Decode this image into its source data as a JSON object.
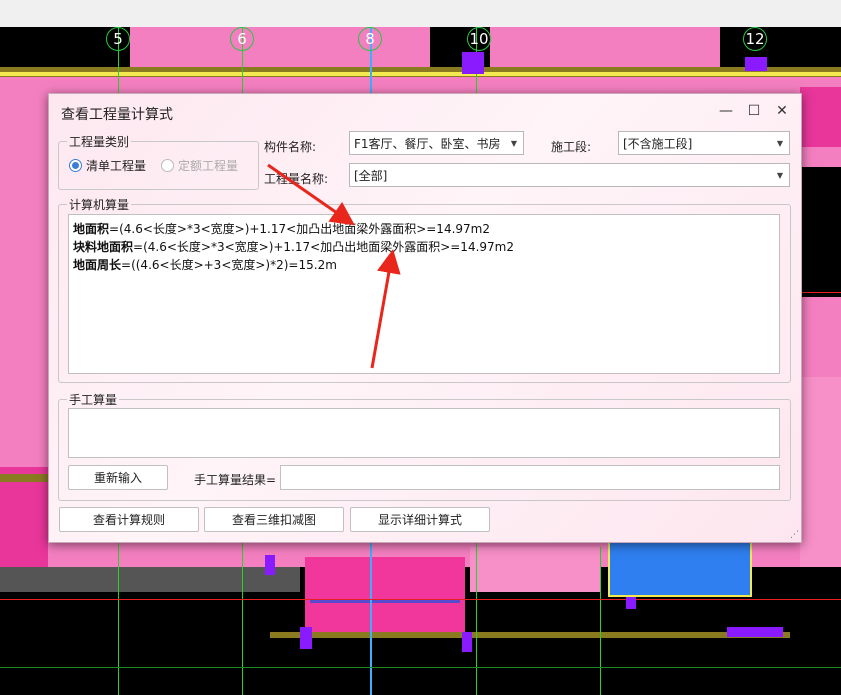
{
  "cad": {
    "axis_numbers": [
      "5",
      "6",
      "8",
      "10",
      "12"
    ]
  },
  "dialog": {
    "title": "查看工程量计算式",
    "minimize_glyph": "—",
    "maximize_glyph": "☐",
    "close_glyph": "✕",
    "category_group": "工程量类别",
    "radio_bill": "清单工程量",
    "radio_quota": "定额工程量",
    "component_label": "构件名称:",
    "component_value": "F1客厅、餐厅、卧室、书房",
    "stage_label": "施工段:",
    "stage_value": "[不含施工段]",
    "quantity_label": "工程量名称:",
    "quantity_value": "[全部]",
    "computer_group": "计算机算量",
    "formulas": [
      {
        "name": "地面积",
        "expr": "=(4.6<长度>*3<宽度>)+1.17<加凸出地面梁外露面积>=14.97m2"
      },
      {
        "name": "块料地面积",
        "expr": "=(4.6<长度>*3<宽度>)+1.17<加凸出地面梁外露面积>=14.97m2"
      },
      {
        "name": "地面周长",
        "expr": "=((4.6<长度>+3<宽度>)*2)=15.2m"
      }
    ],
    "manual_group": "手工算量",
    "reinput_button": "重新输入",
    "manual_result_label": "手工算量结果=",
    "view_rules_button": "查看计算规则",
    "view_3d_button": "查看三维扣减图",
    "show_detail_button": "显示详细计算式"
  },
  "colors": {
    "annotation_arrow": "#e8261c",
    "radio_accent": "#3b7cd6"
  }
}
